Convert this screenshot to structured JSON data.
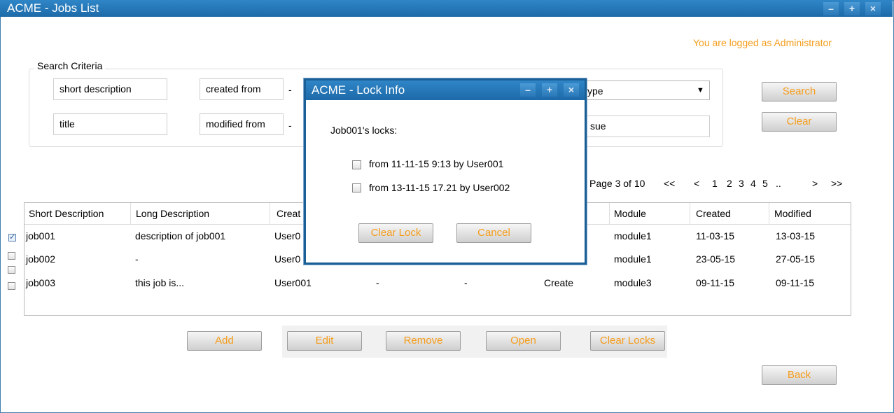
{
  "window": {
    "title": "ACME - Jobs List",
    "min_label": "–",
    "max_label": "+",
    "close_label": "×"
  },
  "logged_as": "You are logged as Administrator",
  "search": {
    "legend": "Search Criteria",
    "short_description": "short description",
    "title": "title",
    "created_from": "created from",
    "modified_from": "modified from",
    "dash": "-",
    "type_value": "ype",
    "issue_value": "sue",
    "search_button": "Search",
    "clear_button": "Clear"
  },
  "pagination": {
    "page_info": "Page 3 of 10",
    "first": "<<",
    "prev": "<",
    "pages": [
      "1",
      "2",
      "3",
      "4",
      "5"
    ],
    "ellipsis": "..",
    "next": ">",
    "last": ">>"
  },
  "table": {
    "columns": {
      "short_description": "Short Description",
      "long_description": "Long Description",
      "created_by": "Creat",
      "module": "Module",
      "created": "Created",
      "modified": "Modified"
    },
    "rows": [
      {
        "checked": true,
        "short": "job001",
        "long": "description of job001",
        "creator": "User0",
        "c4": "",
        "c5": "",
        "action": "",
        "module": "module1",
        "created": "11-03-15",
        "modified": "13-03-15"
      },
      {
        "checked": false,
        "short": "job002",
        "long": "-",
        "creator": "User0",
        "c4": "",
        "c5": "",
        "action": "",
        "module": "module1",
        "created": "23-05-15",
        "modified": "27-05-15"
      },
      {
        "checked": false,
        "short": "job003",
        "long": "this job is...",
        "creator": "User001",
        "c4": "-",
        "c5": "-",
        "action": "Create",
        "module": "module3",
        "created": "09-11-15",
        "modified": "09-11-15"
      }
    ]
  },
  "actions": {
    "add": "Add",
    "edit": "Edit",
    "remove": "Remove",
    "open": "Open",
    "clear_locks": "Clear Locks",
    "back": "Back"
  },
  "dialog": {
    "title": "ACME - Lock Info",
    "heading": "Job001's locks:",
    "locks": [
      "from 11-11-15 9:13 by User001",
      "from 13-11-15 17.21 by User002"
    ],
    "clear_lock_button": "Clear Lock",
    "cancel_button": "Cancel"
  },
  "colors": {
    "accent": "#f59c1a",
    "titlebar": "#1d6aa8",
    "dialog_border": "#1a6097"
  },
  "icons": {
    "dropdown": "chevron-down-icon",
    "check": "check-icon"
  }
}
